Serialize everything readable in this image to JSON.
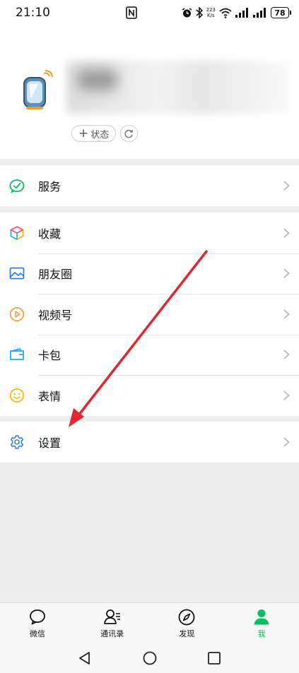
{
  "status_bar": {
    "time": "21:10",
    "speed_value": "223",
    "speed_unit": "K/s",
    "battery": "78"
  },
  "profile": {
    "status_button": "状态",
    "status_plus": "+"
  },
  "menu": {
    "service": {
      "label": "服务",
      "icon": "wechat-pay-icon",
      "color": "#07c160"
    },
    "favorites": {
      "label": "收藏",
      "icon": "cube-icon"
    },
    "moments": {
      "label": "朋友圈",
      "icon": "image-icon",
      "color": "#2b7bef"
    },
    "channels": {
      "label": "视频号",
      "icon": "play-circle-icon",
      "color": "#fa9d3b"
    },
    "cards": {
      "label": "卡包",
      "icon": "wallet-icon",
      "color": "#10aeff"
    },
    "stickers": {
      "label": "表情",
      "icon": "smile-icon",
      "color": "#f5b800"
    },
    "settings": {
      "label": "设置",
      "icon": "gear-icon",
      "color": "#2b7bef"
    }
  },
  "tabbar": {
    "chats": "微信",
    "contacts": "通讯录",
    "discover": "发现",
    "me": "我",
    "active_color": "#07c160"
  },
  "annotation": {
    "arrow_color": "#e0262e"
  }
}
